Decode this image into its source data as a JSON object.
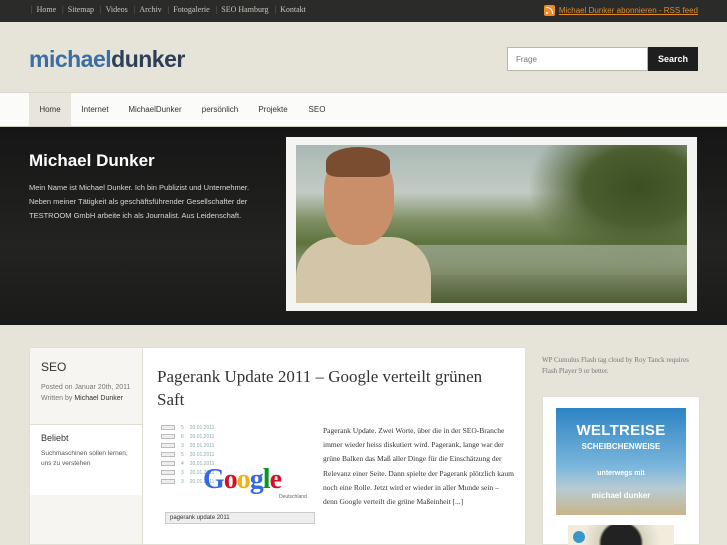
{
  "topbar": {
    "links": [
      "Home",
      "Sitemap",
      "Videos",
      "Archiv",
      "Fotogalerie",
      "SEO Hamburg",
      "Kontakt"
    ],
    "rss_label": "Michael Dunker abonnieren - RSS feed"
  },
  "header": {
    "logo_part1": "michael",
    "logo_part2": "dunker",
    "search_placeholder": "Frage",
    "search_button": "Search"
  },
  "nav": {
    "items": [
      "Home",
      "Internet",
      "MichaelDunker",
      "persönlich",
      "Projekte",
      "SEO"
    ],
    "active": "Home"
  },
  "hero": {
    "title": "Michael Dunker",
    "text": "Mein Name ist Michael Dunker. Ich bin Publizist und Unternehmer. Neben meiner Tätigkeit als geschäftsführender Gesellschafter der TESTROOM GmbH arbeite ich als Journalist. Aus Leidenschaft."
  },
  "sidebar": {
    "category": "SEO",
    "posted_prefix": "Posted on",
    "posted_date": "Januar 20th, 2011",
    "written_prefix": "Written by",
    "author": "Michael Dunker",
    "box_title": "Beliebt",
    "box_text": "Suchmaschinen sollen lernen, uns zu verstehen"
  },
  "post": {
    "title": "Pagerank Update 2011 – Google verteilt grünen Saft",
    "text": "Pagerank Update. Zwei Worte, über die in der SEO-Branche immer wieder heiss diskutiert wird. Pagerank, lange war der grüne Balken das Maß aller Dinge für die Einschätzung der Relevanz einer Seite. Dann spielte der Pagerank plötzlich kaum noch eine Rolle. Jetzt wird er wieder in aller Munde sein – denn Google verteilt die grüne Maßeinheit [...]",
    "thumb_caption": "pagerank update 2011",
    "google_sub": "Deutschland",
    "rank_rows": [
      {
        "num": "5",
        "date": "20.01.2011"
      },
      {
        "num": "6",
        "date": "20.01.2011"
      },
      {
        "num": "3",
        "date": "20.01.2011"
      },
      {
        "num": "5",
        "date": "20.01.2011"
      },
      {
        "num": "4",
        "date": "20.01.2011"
      },
      {
        "num": "3",
        "date": "20.01.2011"
      },
      {
        "num": "3",
        "date": "20.01.2011"
      }
    ]
  },
  "right": {
    "cumulus_text": "WP Cumulus Flash tag cloud by Roy Tanck requires Flash Player 9 or better.",
    "banner": {
      "line1": "WELTREISE",
      "line2": "SCHEIBCHENWEISE",
      "line3": "unterwegs mit",
      "line4": "michael dunker"
    }
  },
  "colors": {
    "topbar": "#2b2b29",
    "logo_blue": "#3b6ea3",
    "logo_dark": "#2d3e56",
    "hero": "#1e1e1d",
    "rss": "#e08a2a"
  }
}
